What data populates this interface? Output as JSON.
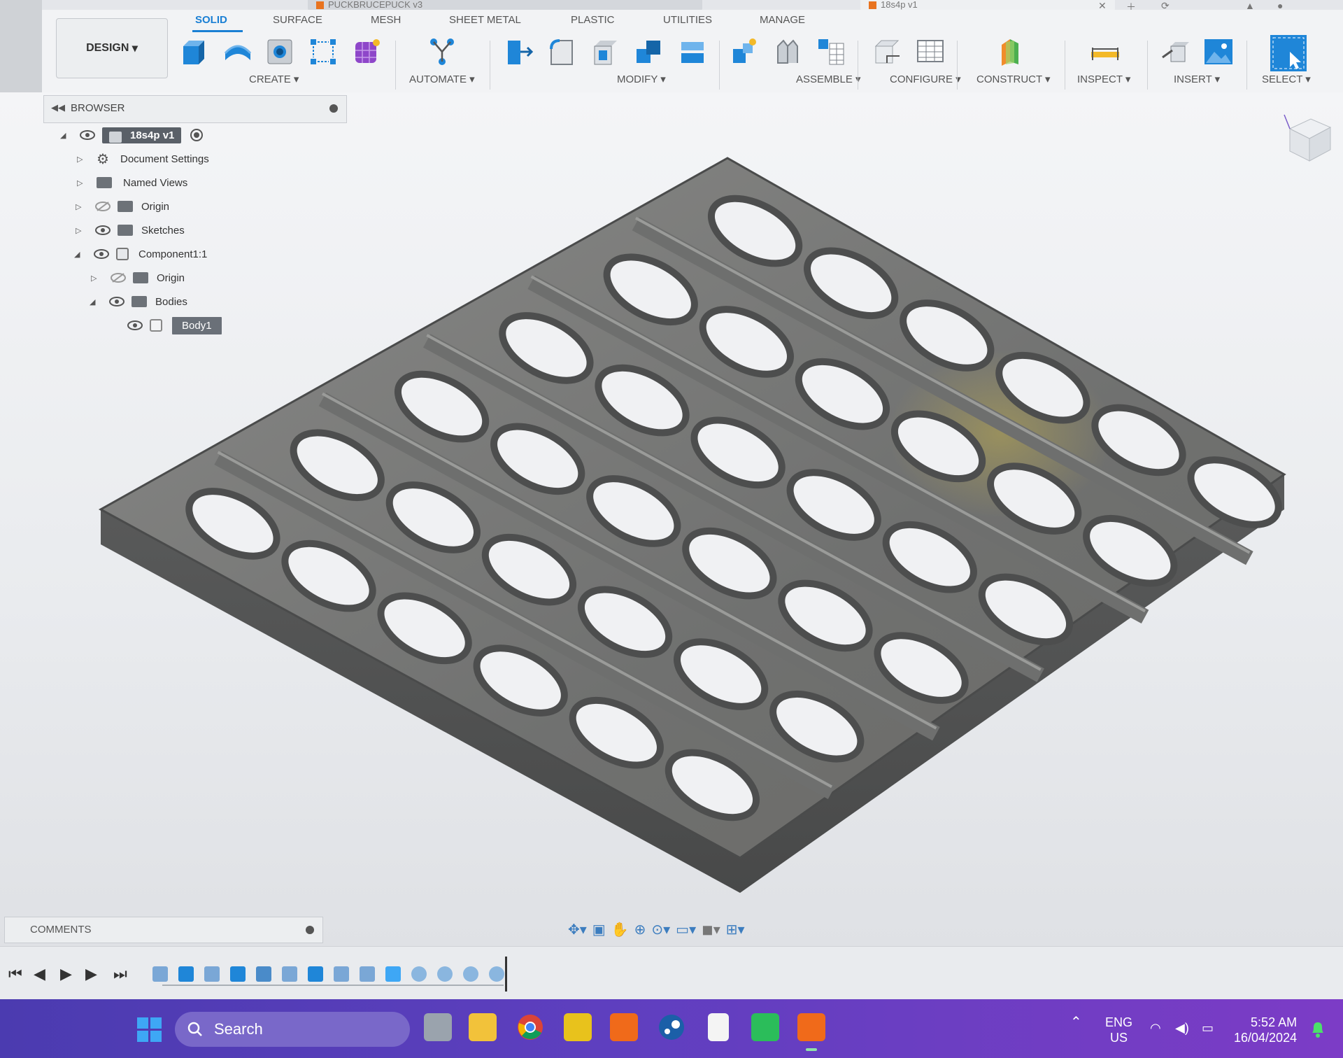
{
  "window": {
    "doc_tabs": [
      "PUCKBRUCEPUCK v3",
      "18s4p v1"
    ]
  },
  "toolbar": {
    "workspace": "DESIGN",
    "tabs": [
      {
        "label": "SOLID",
        "active": true
      },
      {
        "label": "SURFACE"
      },
      {
        "label": "MESH"
      },
      {
        "label": "SHEET METAL"
      },
      {
        "label": "PLASTIC"
      },
      {
        "label": "UTILITIES"
      },
      {
        "label": "MANAGE"
      }
    ],
    "groups": [
      "CREATE",
      "AUTOMATE",
      "MODIFY",
      "ASSEMBLE",
      "CONFIGURE",
      "CONSTRUCT",
      "INSPECT",
      "INSERT",
      "SELECT"
    ],
    "accent": "#1a7fd4"
  },
  "browser": {
    "title": "BROWSER",
    "root": "18s4p v1",
    "items": [
      {
        "label": "Document Settings",
        "icon": "gear-icon"
      },
      {
        "label": "Named Views",
        "icon": "folder-icon"
      },
      {
        "label": "Origin",
        "icon": "folder-icon",
        "hidden": true
      },
      {
        "label": "Sketches",
        "icon": "folder-icon"
      },
      {
        "label": "Component1:1",
        "icon": "component-icon"
      },
      {
        "label": "Origin",
        "icon": "folder-icon",
        "hidden": true
      },
      {
        "label": "Bodies",
        "icon": "folder-icon"
      },
      {
        "label": "Body1",
        "icon": "body-icon"
      }
    ]
  },
  "comments": {
    "title": "COMMENTS"
  },
  "taskbar": {
    "search_label": "Search",
    "language": "ENG",
    "region": "US",
    "time": "5:52 AM",
    "date": "16/04/2024"
  }
}
